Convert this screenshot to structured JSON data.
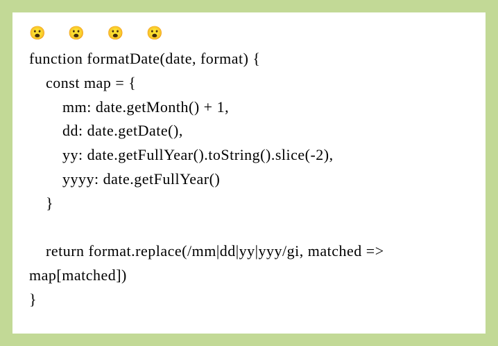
{
  "emojis": "😮  😮  😮  😮",
  "code": {
    "line1": "function formatDate(date, format) {",
    "line2": "    const map = {",
    "line3": "        mm: date.getMonth() + 1,",
    "line4": "        dd: date.getDate(),",
    "line5": "        yy: date.getFullYear().toString().slice(-2),",
    "line6": "        yyyy: date.getFullYear()",
    "line7": "    }",
    "line8": "",
    "line9": "    return format.replace(/mm|dd|yy|yyy/gi, matched => map[matched])",
    "line10": "}"
  }
}
